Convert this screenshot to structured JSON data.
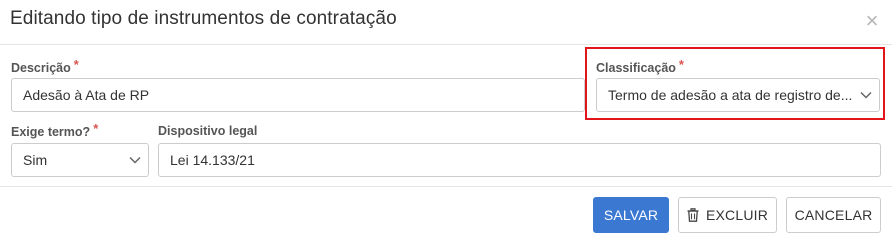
{
  "dialog": {
    "title": "Editando tipo de instrumentos de contratação",
    "close_glyph": "×"
  },
  "form": {
    "descricao": {
      "label": "Descrição",
      "required_mark": "*",
      "value": "Adesão à Ata de RP"
    },
    "classificacao": {
      "label": "Classificação",
      "required_mark": "*",
      "value": "Termo de adesão a ata de registro de...",
      "icon": "chevron-down-icon"
    },
    "exige_termo": {
      "label": "Exige termo?",
      "required_mark": "*",
      "value": "Sim",
      "icon": "chevron-down-icon"
    },
    "dispositivo_legal": {
      "label": "Dispositivo legal",
      "value": "Lei 14.133/21"
    }
  },
  "footer": {
    "save_label": "SALVAR",
    "delete_label": "EXCLUIR",
    "delete_icon": "trash-icon",
    "cancel_label": "CANCELAR"
  },
  "colors": {
    "primary": "#3a78d1",
    "required": "#d9534f",
    "highlight": "#e0161b"
  }
}
